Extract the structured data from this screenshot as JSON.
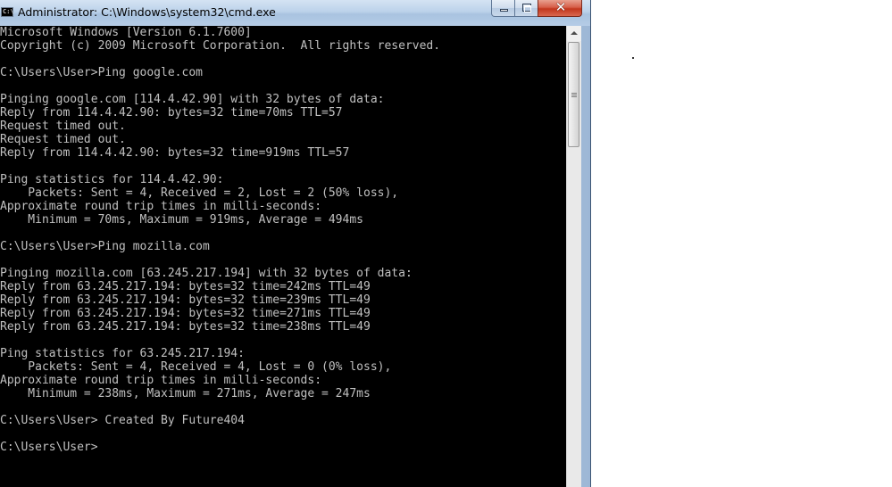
{
  "window": {
    "title": "Administrator: C:\\Windows\\system32\\cmd.exe",
    "icon_text": "C:\\",
    "close_glyph": "✕"
  },
  "console": {
    "lines": [
      "Microsoft Windows [Version 6.1.7600]",
      "Copyright (c) 2009 Microsoft Corporation.  All rights reserved.",
      "",
      "C:\\Users\\User>Ping google.com",
      "",
      "Pinging google.com [114.4.42.90] with 32 bytes of data:",
      "Reply from 114.4.42.90: bytes=32 time=70ms TTL=57",
      "Request timed out.",
      "Request timed out.",
      "Reply from 114.4.42.90: bytes=32 time=919ms TTL=57",
      "",
      "Ping statistics for 114.4.42.90:",
      "    Packets: Sent = 4, Received = 2, Lost = 2 (50% loss),",
      "Approximate round trip times in milli-seconds:",
      "    Minimum = 70ms, Maximum = 919ms, Average = 494ms",
      "",
      "C:\\Users\\User>Ping mozilla.com",
      "",
      "Pinging mozilla.com [63.245.217.194] with 32 bytes of data:",
      "Reply from 63.245.217.194: bytes=32 time=242ms TTL=49",
      "Reply from 63.245.217.194: bytes=32 time=239ms TTL=49",
      "Reply from 63.245.217.194: bytes=32 time=271ms TTL=49",
      "Reply from 63.245.217.194: bytes=32 time=238ms TTL=49",
      "",
      "Ping statistics for 63.245.217.194:",
      "    Packets: Sent = 4, Received = 4, Lost = 0 (0% loss),",
      "Approximate round trip times in milli-seconds:",
      "    Minimum = 238ms, Maximum = 271ms, Average = 247ms",
      "",
      "C:\\Users\\User> Created By Future404",
      "",
      "C:\\Users\\User>"
    ]
  }
}
